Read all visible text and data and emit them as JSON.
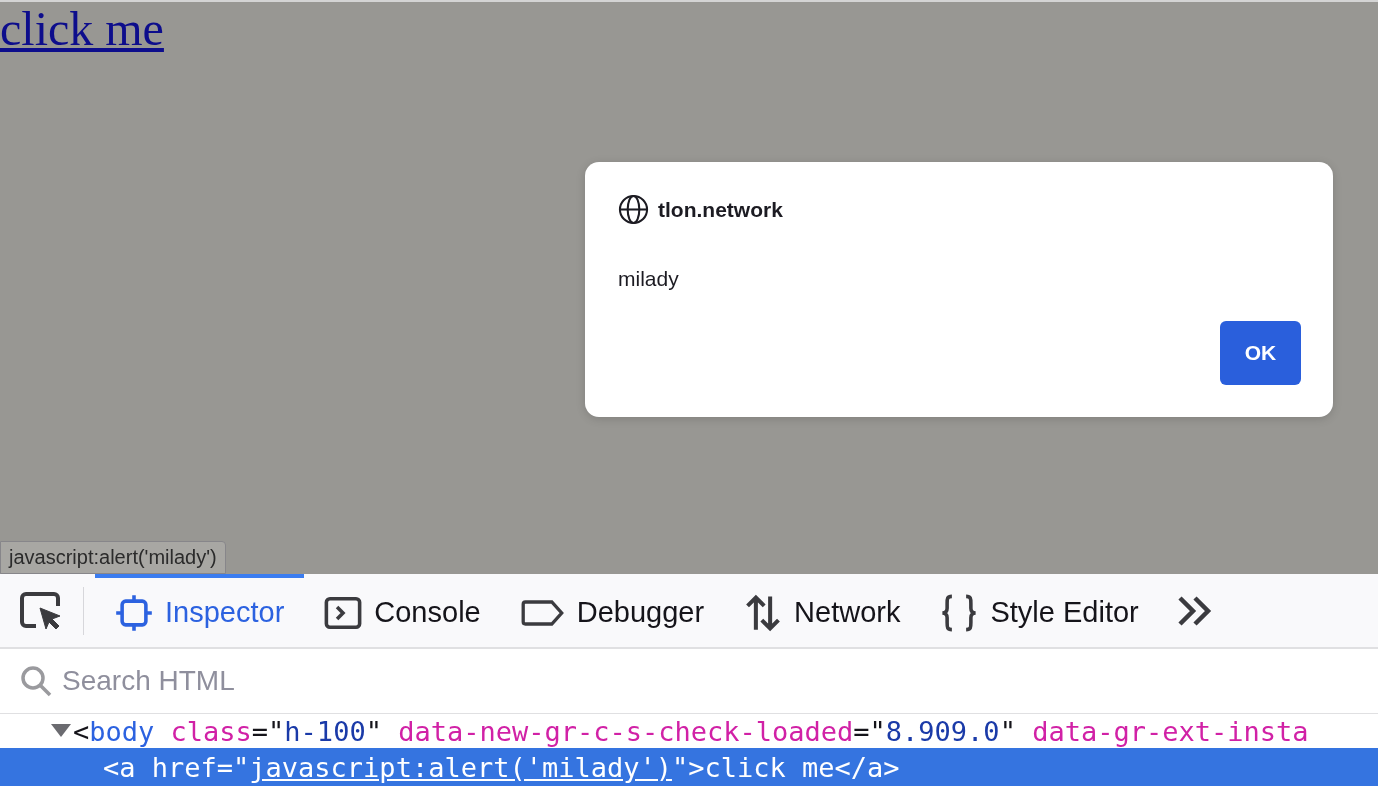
{
  "page": {
    "link": "click me",
    "status_url": "javascript:alert('milady')"
  },
  "dialog": {
    "origin": "tlon.network",
    "message": "milady",
    "button": "OK"
  },
  "devtools": {
    "tabs": [
      {
        "label": "Inspector",
        "kind": "inspector",
        "selected": true
      },
      {
        "label": "Console",
        "kind": "console",
        "selected": false
      },
      {
        "label": "Debugger",
        "kind": "debugger",
        "selected": false
      },
      {
        "label": "Network",
        "kind": "network",
        "selected": false
      },
      {
        "label": "Style Editor",
        "kind": "style",
        "selected": false
      }
    ],
    "search": {
      "placeholder": "Search HTML"
    },
    "markup": [
      {
        "expanded": true,
        "selected": false,
        "tokens": [
          {
            "kind": "punct",
            "text": "<"
          },
          {
            "kind": "tag",
            "text": "body"
          },
          {
            "kind": "attr",
            "text": " class"
          },
          {
            "kind": "punct",
            "text": "=\""
          },
          {
            "kind": "value",
            "text": "h-100"
          },
          {
            "kind": "punct",
            "text": "\""
          },
          {
            "kind": "attr",
            "text": " data-new-gr-c-s-check-loaded"
          },
          {
            "kind": "punct",
            "text": "=\""
          },
          {
            "kind": "value",
            "text": "8.909.0"
          },
          {
            "kind": "punct",
            "text": "\""
          },
          {
            "kind": "attr",
            "text": " data-gr-ext-insta"
          }
        ]
      },
      {
        "selected": true,
        "tokens": [
          {
            "kind": "punct",
            "text": "<"
          },
          {
            "kind": "tag",
            "text": "a"
          },
          {
            "kind": "attr",
            "text": " href"
          },
          {
            "kind": "punct",
            "text": "=\""
          },
          {
            "kind": "link",
            "text": "javascript:alert('milady')"
          },
          {
            "kind": "punct",
            "text": "\">click me</"
          },
          {
            "kind": "tag",
            "text": "a"
          },
          {
            "kind": "punct",
            "text": ">"
          }
        ]
      }
    ]
  }
}
